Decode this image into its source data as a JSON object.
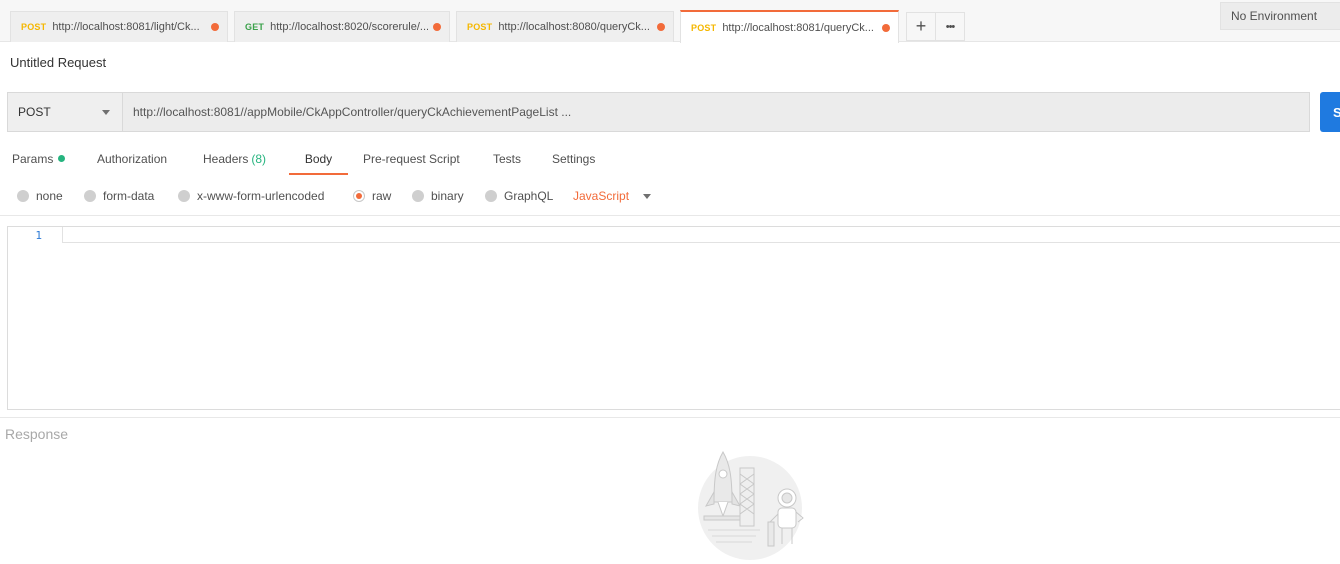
{
  "tabs": [
    {
      "method": "POST",
      "url": "http://localhost:8081/light/Ck...",
      "unsaved": true,
      "active": false
    },
    {
      "method": "GET",
      "url": "http://localhost:8020/scorerule/...",
      "unsaved": true,
      "active": false
    },
    {
      "method": "POST",
      "url": "http://localhost:8080/queryCk...",
      "unsaved": true,
      "active": false
    },
    {
      "method": "POST",
      "url": "http://localhost:8081/queryCk...",
      "unsaved": true,
      "active": true
    }
  ],
  "tab_actions": {
    "new_tab": "+",
    "more": "•••"
  },
  "environment": "No Environment",
  "request": {
    "title": "Untitled Request",
    "method": "POST",
    "url": "http://localhost:8081//appMobile/CkAppController/queryCkAchievementPageList ...",
    "send_label": "S"
  },
  "request_tabs": [
    {
      "label": "Params",
      "indicator": "dot"
    },
    {
      "label": "Authorization"
    },
    {
      "label": "Headers",
      "count": "(8)"
    },
    {
      "label": "Body",
      "active": true
    },
    {
      "label": "Pre-request Script"
    },
    {
      "label": "Tests"
    },
    {
      "label": "Settings"
    }
  ],
  "body_types": [
    {
      "label": "none",
      "selected": false
    },
    {
      "label": "form-data",
      "selected": false
    },
    {
      "label": "x-www-form-urlencoded",
      "selected": false
    },
    {
      "label": "raw",
      "selected": true
    },
    {
      "label": "binary",
      "selected": false
    },
    {
      "label": "GraphQL",
      "selected": false
    }
  ],
  "raw_language": "JavaScript",
  "editor": {
    "line_numbers": [
      "1"
    ],
    "content": ""
  },
  "response_label": "Response",
  "colors": {
    "accent": "#f26b3a",
    "post": "#f5b700",
    "get": "#3aa14a",
    "send": "#1f7ae0",
    "params_dot": "#26b47f"
  }
}
